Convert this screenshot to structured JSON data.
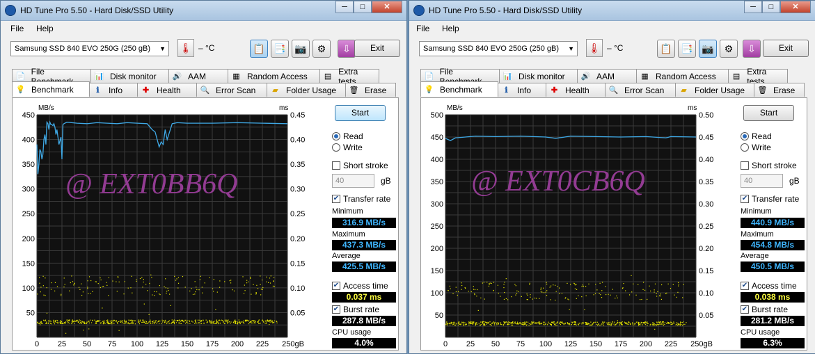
{
  "common": {
    "title": "HD Tune Pro 5.50 - Hard Disk/SSD Utility",
    "menu": [
      "File",
      "Help"
    ],
    "drive": "Samsung SSD 840 EVO 250G (250 gB)",
    "temp": "– °C",
    "exit": "Exit",
    "tabs_top": [
      "File Benchmark",
      "Disk monitor",
      "AAM",
      "Random Access",
      "Extra tests"
    ],
    "tabs_bottom": [
      "Benchmark",
      "Info",
      "Health",
      "Error Scan",
      "Folder Usage",
      "Erase"
    ],
    "start": "Start",
    "read": "Read",
    "write": "Write",
    "short_stroke": "Short stroke",
    "stroke_value": "40",
    "stroke_unit": "gB",
    "transfer_rate": "Transfer rate",
    "minimum": "Minimum",
    "maximum": "Maximum",
    "average": "Average",
    "access_time": "Access time",
    "burst_rate": "Burst rate",
    "cpu_usage": "CPU usage",
    "wbtn_min": "─",
    "wbtn_max": "□",
    "wbtn_close": "✕",
    "colors": {
      "line": "#3fa9e6",
      "dots": "#e8e800",
      "grid": "#3a3a3a",
      "bg": "#111111"
    }
  },
  "left": {
    "watermark": "@ EXT0BB6Q",
    "minimum": "316.9 MB/s",
    "maximum": "437.3 MB/s",
    "average": "425.5 MB/s",
    "access_time": "0.037 ms",
    "burst_rate": "287.8 MB/s",
    "cpu_usage": "4.0%"
  },
  "right": {
    "watermark": "@ EXT0CB6Q",
    "minimum": "440.9 MB/s",
    "maximum": "454.8 MB/s",
    "average": "450.5 MB/s",
    "access_time": "0.038 ms",
    "burst_rate": "281.2 MB/s",
    "cpu_usage": "6.3%"
  },
  "chart_data": [
    {
      "type": "line",
      "xlabel": "gB",
      "ylabel": "MB/s",
      "y2label": "ms",
      "x_ticks": [
        "0",
        "25",
        "50",
        "75",
        "100",
        "125",
        "150",
        "175",
        "200",
        "225",
        "250gB"
      ],
      "y_ticks": [
        "50",
        "100",
        "150",
        "200",
        "250",
        "300",
        "350",
        "400",
        "450"
      ],
      "y2_ticks": [
        "0.05",
        "0.10",
        "0.15",
        "0.20",
        "0.25",
        "0.30",
        "0.35",
        "0.40",
        "0.45"
      ],
      "xlim": [
        0,
        250
      ],
      "ylim": [
        0,
        450
      ],
      "y2lim": [
        0,
        0.45
      ],
      "grid": true,
      "series": [
        {
          "name": "Transfer rate",
          "x": [
            0,
            1,
            2,
            3,
            4,
            5,
            6,
            7,
            8,
            9,
            10,
            11,
            12,
            13,
            14,
            15,
            16,
            17,
            18,
            19,
            20,
            22,
            24,
            25,
            26,
            27,
            30,
            40,
            50,
            60,
            70,
            80,
            90,
            100,
            110,
            115,
            118,
            120,
            122,
            124,
            126,
            128,
            130,
            135,
            140,
            150,
            175,
            200,
            225,
            250
          ],
          "y": [
            390,
            330,
            350,
            380,
            375,
            360,
            370,
            400,
            410,
            390,
            435,
            432,
            420,
            435,
            430,
            430,
            428,
            432,
            425,
            410,
            420,
            390,
            405,
            360,
            430,
            432,
            435,
            433,
            432,
            434,
            433,
            432,
            434,
            433,
            432,
            420,
            415,
            400,
            385,
            395,
            390,
            420,
            400,
            432,
            434,
            433,
            433,
            434,
            433,
            432
          ]
        },
        {
          "name": "Access time",
          "values_ms_range": [
            0.005,
            0.128
          ]
        }
      ]
    },
    {
      "type": "line",
      "xlabel": "gB",
      "ylabel": "MB/s",
      "y2label": "ms",
      "x_ticks": [
        "0",
        "25",
        "50",
        "75",
        "100",
        "125",
        "150",
        "175",
        "200",
        "225",
        "250gB"
      ],
      "y_ticks": [
        "50",
        "100",
        "150",
        "200",
        "250",
        "300",
        "350",
        "400",
        "450",
        "500"
      ],
      "y2_ticks": [
        "0.05",
        "0.10",
        "0.15",
        "0.20",
        "0.25",
        "0.30",
        "0.35",
        "0.40",
        "0.45",
        "0.50"
      ],
      "xlim": [
        0,
        250
      ],
      "ylim": [
        0,
        500
      ],
      "y2lim": [
        0,
        0.5
      ],
      "grid": true,
      "series": [
        {
          "name": "Transfer rate",
          "x": [
            0,
            5,
            10,
            20,
            30,
            50,
            75,
            100,
            110,
            125,
            150,
            175,
            200,
            220,
            225,
            250
          ],
          "y": [
            447,
            442,
            448,
            450,
            452,
            451,
            452,
            450,
            447,
            452,
            451,
            450,
            451,
            448,
            451,
            450
          ]
        },
        {
          "name": "Access time",
          "values_ms_range": [
            0.005,
            0.14
          ]
        }
      ]
    }
  ]
}
